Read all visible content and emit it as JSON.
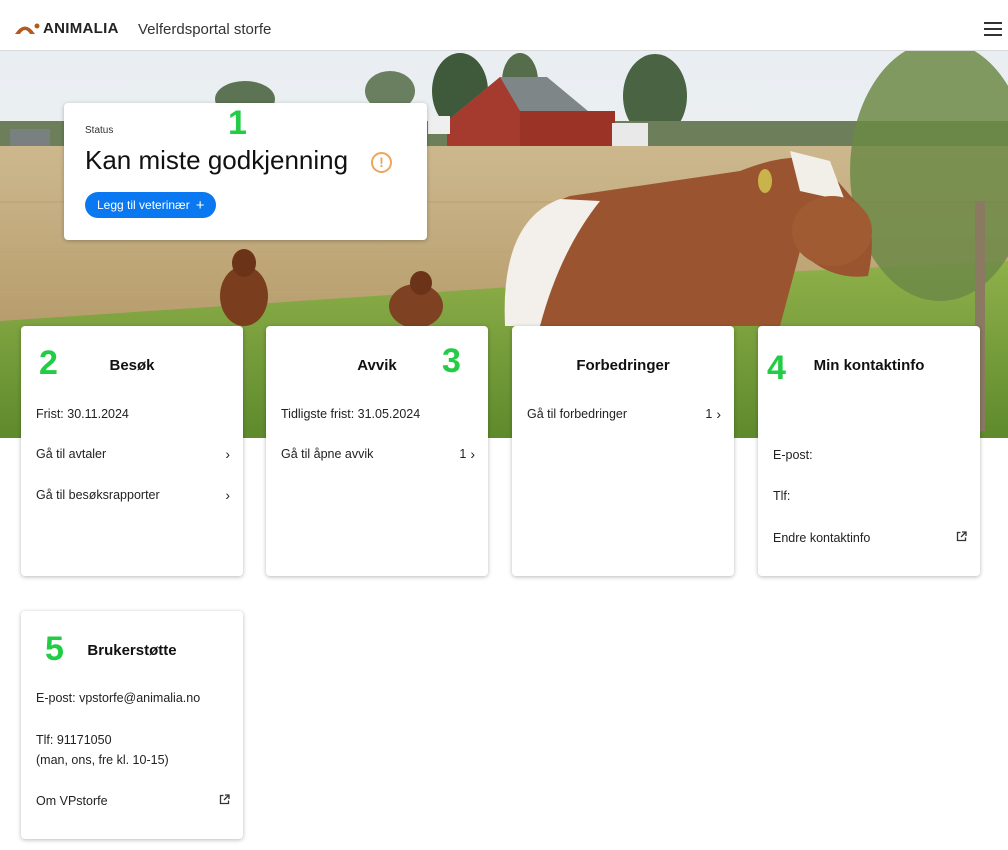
{
  "header": {
    "logo_text": "ANIMALIA",
    "app_title": "Velferdsportal storfe",
    "menu_icon": "hamburger-menu-icon"
  },
  "status_card": {
    "label": "Status",
    "value": "Kan miste godkjenning",
    "icon": "warning-icon",
    "button_label": "Legg til veterinær"
  },
  "annotations": [
    "1",
    "2",
    "3",
    "4",
    "5"
  ],
  "cards": {
    "besok": {
      "title": "Besøk",
      "deadline": "Frist:  30.11.2024",
      "link_agreements": "Gå til avtaler",
      "link_reports": "Gå til besøksrapporter"
    },
    "avvik": {
      "title": "Avvik",
      "deadline": "Tidligste frist: 31.05.2024",
      "link_open": "Gå til åpne avvik",
      "open_count": "1"
    },
    "forbedringer": {
      "title": "Forbedringer",
      "link": "Gå til forbedringer",
      "count": "1"
    },
    "kontakt": {
      "title": "Min kontaktinfo",
      "email_label": "E-post:",
      "phone_label": "Tlf:",
      "edit_link": "Endre kontaktinfo"
    },
    "support": {
      "title": "Brukerstøtte",
      "email": "E-post: vpstorfe@animalia.no",
      "phone": "Tlf: 91171050",
      "hours": "(man, ons, fre kl. 10-15)",
      "about_link": "Om VPstorfe"
    }
  },
  "colors": {
    "primary": "#0a78f0",
    "warning": "#f0a45a",
    "annotation": "#22cc44",
    "logo_accent": "#b35a1f"
  }
}
